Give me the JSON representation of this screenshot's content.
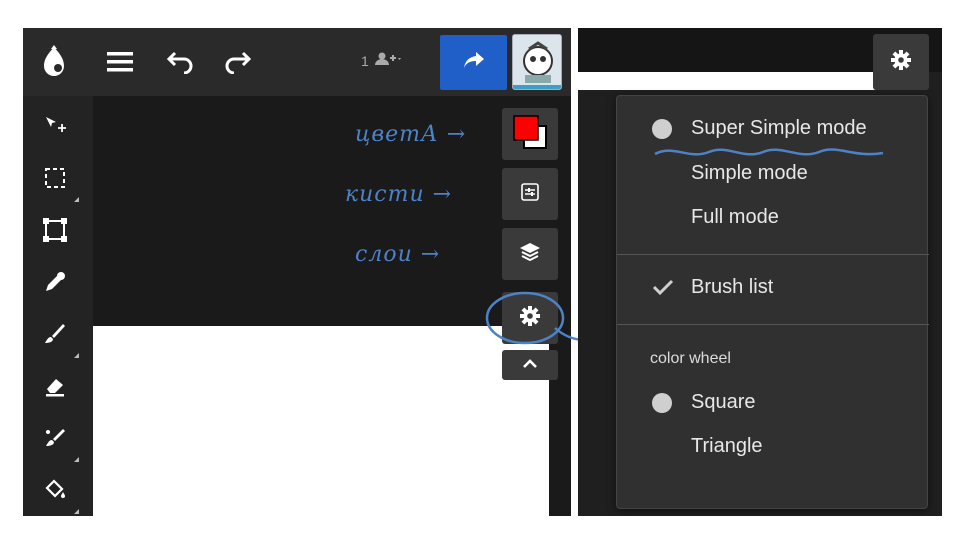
{
  "left_panel": {
    "users_count": "1",
    "annotations": {
      "colors": "цветА →",
      "brushes": "кисти →",
      "layers": "слои →"
    }
  },
  "menu": {
    "items": [
      {
        "label": "Super Simple mode"
      },
      {
        "label": "Simple mode"
      },
      {
        "label": "Full mode"
      }
    ],
    "brush_list": "Brush list",
    "color_wheel_header": "color wheel",
    "color_wheel_items": [
      {
        "label": "Square"
      },
      {
        "label": "Triangle"
      }
    ]
  },
  "colors": {
    "accent": "#1f5fc7",
    "annotation": "#4e82c6",
    "primary_color": "#ff0000"
  },
  "icons": [
    "app-logo-icon",
    "menu-icon",
    "undo-icon",
    "redo-icon",
    "add-user-icon",
    "share-icon",
    "move-icon",
    "select-icon",
    "transform-icon",
    "eyedropper-icon",
    "brush-icon",
    "eraser-icon",
    "smudge-icon",
    "fill-icon",
    "color-swatch-icon",
    "brush-settings-icon",
    "layers-icon",
    "gear-icon",
    "chevron-up-icon",
    "checkmark-icon"
  ]
}
